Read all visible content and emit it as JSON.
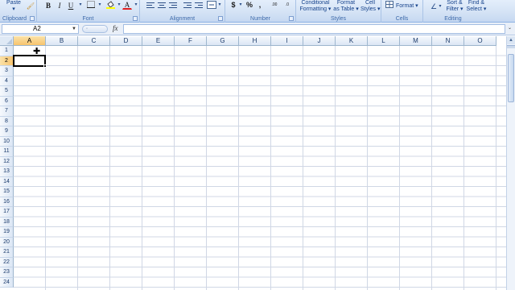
{
  "ribbon": {
    "clipboard": {
      "label": "Clipboard",
      "paste": "Paste",
      "paste_arrow": "▾"
    },
    "font": {
      "label": "Font",
      "bold": "B",
      "italic": "I",
      "underline": "U",
      "font_color": "A"
    },
    "alignment": {
      "label": "Alignment"
    },
    "number": {
      "label": "Number",
      "currency": "$",
      "percent": "%",
      "comma": ",",
      "increase_decimal": ".00",
      "decrease_decimal": ".0"
    },
    "styles": {
      "label": "Styles",
      "conditional_formatting": "Conditional\nFormatting ▾",
      "format_as_table": "Format\nas Table ▾",
      "cell_styles": "Cell\nStyles ▾"
    },
    "cells": {
      "label": "Cells",
      "format": "Format ▾"
    },
    "editing": {
      "label": "Editing",
      "sort_filter": "Sort &\nFilter ▾",
      "find_select": "Find &\nSelect ▾"
    }
  },
  "formula_bar": {
    "name_box": "A2",
    "fx": "fx",
    "formula": ""
  },
  "columns": [
    "A",
    "B",
    "C",
    "D",
    "E",
    "F",
    "G",
    "H",
    "I",
    "J",
    "K",
    "L",
    "M",
    "N",
    "O"
  ],
  "rows": [
    "1",
    "2",
    "3",
    "4",
    "5",
    "6",
    "7",
    "8",
    "9",
    "10",
    "11",
    "12",
    "13",
    "14",
    "15",
    "16",
    "17",
    "18",
    "19",
    "20",
    "21",
    "22",
    "23",
    "24"
  ],
  "selection": {
    "column": "A",
    "row": "2"
  },
  "colors": {
    "ribbon_bg": "#d5e3f5",
    "header_selected": "#f7c46e",
    "gridline": "#d0d7e5"
  }
}
